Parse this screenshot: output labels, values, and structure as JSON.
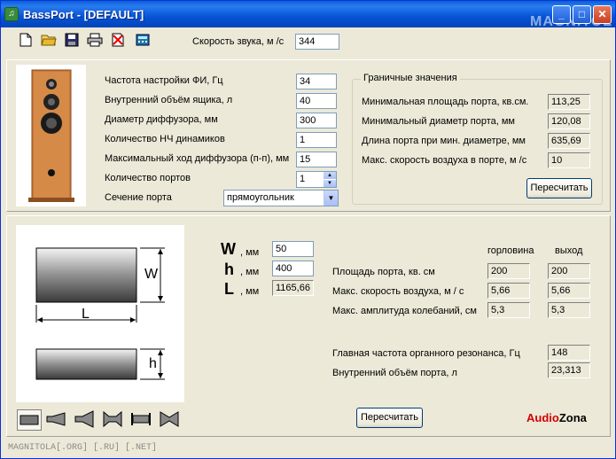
{
  "window": {
    "title": "BassPort - [DEFAULT]",
    "watermark": "MAGNITOL",
    "minimize": "_",
    "maximize": "□",
    "close": "✕"
  },
  "toolbar": {
    "icons": [
      "new-file-icon",
      "open-folder-icon",
      "save-icon",
      "print-icon",
      "delete-icon",
      "calculator-icon"
    ],
    "sound_speed_label": "Скорость звука, м /с",
    "sound_speed_value": "344"
  },
  "params": {
    "tuning_freq_label": "Частота настройки ФИ, Гц",
    "tuning_freq_value": "34",
    "box_volume_label": "Внутренний объём ящика, л",
    "box_volume_value": "40",
    "cone_diameter_label": "Диаметр диффузора, мм",
    "cone_diameter_value": "300",
    "woofer_count_label": "Количество НЧ динамиков",
    "woofer_count_value": "1",
    "max_excursion_label": "Максимальный ход диффузора (п-п), мм",
    "max_excursion_value": "15",
    "port_count_label": "Количество портов",
    "port_count_value": "1",
    "port_section_label": "Сечение порта",
    "port_section_value": "прямоугольник"
  },
  "limits": {
    "title": "Граничные значения",
    "min_area_label": "Минимальная площадь порта, кв.см.",
    "min_area_value": "113,25",
    "min_diameter_label": "Минимальный диаметр порта, мм",
    "min_diameter_value": "120,08",
    "port_length_label": "Длина порта при мин. диаметре, мм",
    "port_length_value": "635,69",
    "max_air_speed_label": "Макс. скорость воздуха в порте, м /с",
    "max_air_speed_value": "10",
    "recalc_label": "Пересчитать"
  },
  "diagram": {
    "w_letter": "W",
    "l_letter": "L",
    "h_letter": "h"
  },
  "dims": {
    "w_label": "W",
    "h_label": "h",
    "l_label": "L",
    "unit": ", мм",
    "w_value": "50",
    "h_value": "400",
    "l_value": "1165,66"
  },
  "results": {
    "col_throat": "горловина",
    "col_exit": "выход",
    "area_label": "Площадь порта, кв. см",
    "area_throat": "200",
    "area_exit": "200",
    "speed_label": "Макс. скорость воздуха, м / с",
    "speed_throat": "5,66",
    "speed_exit": "5,66",
    "amplitude_label": "Макс. амплитуда колебаний, см",
    "amplitude_throat": "5,3",
    "amplitude_exit": "5,3",
    "organ_freq_label": "Главная частота органного резонанса, Гц",
    "organ_freq_value": "148",
    "port_volume_label": "Внутренний объём порта, л",
    "port_volume_value": "23,313",
    "recalc_label": "Пересчитать"
  },
  "brand": {
    "audio": "Audio",
    "zona": "Zona",
    "audio_color": "#d40000",
    "zona_color": "#000000"
  },
  "status": "MAGNITOLA[.ORG] [.RU] [.NET]"
}
